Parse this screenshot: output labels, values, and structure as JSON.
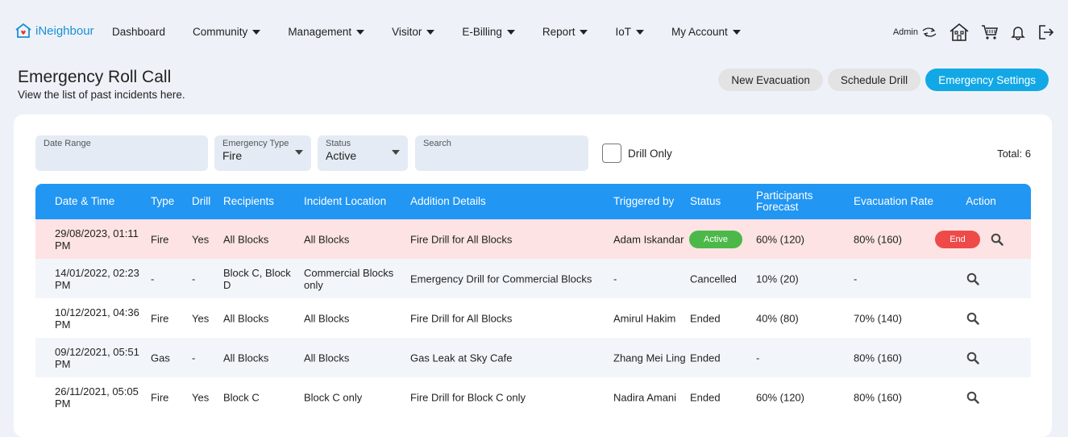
{
  "app": {
    "logo": "iNeighbour"
  },
  "nav": {
    "items": [
      {
        "label": "Dashboard",
        "dropdown": false
      },
      {
        "label": "Community",
        "dropdown": true
      },
      {
        "label": "Management",
        "dropdown": true
      },
      {
        "label": "Visitor",
        "dropdown": true
      },
      {
        "label": "E-Billing",
        "dropdown": true
      },
      {
        "label": "Report",
        "dropdown": true
      },
      {
        "label": "IoT",
        "dropdown": true
      },
      {
        "label": "My Account",
        "dropdown": true
      }
    ],
    "admin_label": "Admin"
  },
  "page": {
    "title": "Emergency Roll Call",
    "subtitle": "View the list of past incidents here."
  },
  "actions": {
    "new_evacuation": "New Evacuation",
    "schedule_drill": "Schedule Drill",
    "emergency_settings": "Emergency Settings"
  },
  "filters": {
    "date_range": {
      "label": "Date Range",
      "value": ""
    },
    "emergency_type": {
      "label": "Emergency Type",
      "value": "Fire"
    },
    "status": {
      "label": "Status",
      "value": "Active"
    },
    "search": {
      "label": "Search",
      "value": ""
    },
    "drill_only": {
      "label": "Drill Only",
      "checked": false
    },
    "total": "Total: 6"
  },
  "table": {
    "headers": [
      "Date & Time",
      "Type",
      "Drill",
      "Recipients",
      "Incident Location",
      "Addition Details",
      "Triggered by",
      "Status",
      "Participants Forecast",
      "Evacuation Rate",
      "Action"
    ],
    "end_label": "End",
    "rows": [
      {
        "datetime": "29/08/2023, 01:11 PM",
        "type": "Fire",
        "drill": "Yes",
        "recipients": "All Blocks",
        "location": "All Blocks",
        "details": "Fire Drill for All Blocks",
        "triggered_by": "Adam Iskandar",
        "status": "Active",
        "forecast": "60% (120)",
        "rate": "80% (160)"
      },
      {
        "datetime": "14/01/2022, 02:23 PM",
        "type": "-",
        "drill": "-",
        "recipients": "Block C, Block D",
        "location": "Commercial Blocks only",
        "details": "Emergency Drill for Commercial Blocks",
        "triggered_by": "-",
        "status": "Cancelled",
        "forecast": "10% (20)",
        "rate": "-"
      },
      {
        "datetime": "10/12/2021, 04:36 PM",
        "type": "Fire",
        "drill": "Yes",
        "recipients": "All Blocks",
        "location": "All Blocks",
        "details": "Fire Drill for All Blocks",
        "triggered_by": "Amirul Hakim",
        "status": "Ended",
        "forecast": "40% (80)",
        "rate": "70% (140)"
      },
      {
        "datetime": "09/12/2021, 05:51 PM",
        "type": "Gas",
        "drill": "-",
        "recipients": "All Blocks",
        "location": "All Blocks",
        "details": "Gas Leak at Sky Cafe",
        "triggered_by": "Zhang Mei Ling",
        "status": "Ended",
        "forecast": "-",
        "rate": "80% (160)"
      },
      {
        "datetime": "26/11/2021, 05:05 PM",
        "type": "Fire",
        "drill": "Yes",
        "recipients": "Block C",
        "location": "Block C only",
        "details": "Fire Drill for Block C only",
        "triggered_by": "Nadira Amani",
        "status": "Ended",
        "forecast": "60% (120)",
        "rate": "80% (160)"
      }
    ]
  },
  "colors": {
    "primary": "#2196f3",
    "accent": "#12a8e6",
    "active": "#4cb849",
    "danger": "#ef4a4a",
    "highlight_row": "#fde3e3"
  }
}
